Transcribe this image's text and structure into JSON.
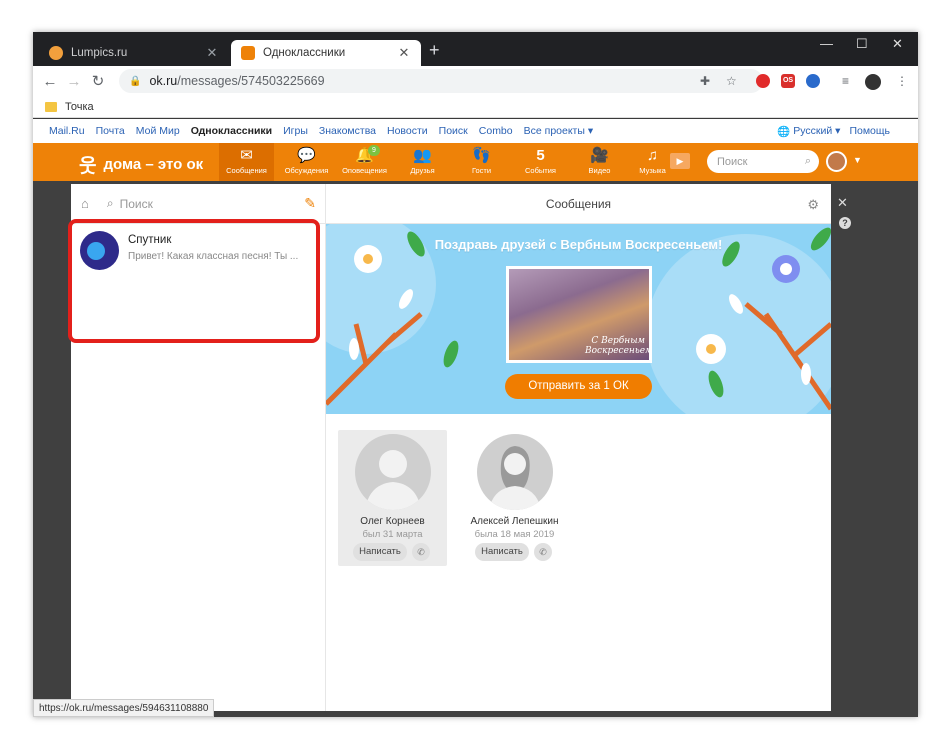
{
  "tabs": [
    {
      "title": "Lumpics.ru",
      "color": "#f2a03d"
    },
    {
      "title": "Одноклассники",
      "color": "#ee8208"
    }
  ],
  "toolbar": {
    "url_host": "ok.ru",
    "url_path": "/messages/574503225669",
    "ext_os": "OS"
  },
  "bookmark": "Точка",
  "portal": {
    "links": [
      "Mail.Ru",
      "Почта",
      "Мой Мир",
      "Одноклассники",
      "Игры",
      "Знакомства",
      "Новости",
      "Поиск",
      "Combo",
      "Все проекты ▾"
    ],
    "current": "Одноклассники",
    "language": "Русский ▾",
    "help": "Помощь"
  },
  "ok": {
    "logo": "дома – это ок",
    "nav": [
      {
        "label": "Сообщения",
        "icon": "✉",
        "active": true
      },
      {
        "label": "Обсуждения",
        "icon": "💬"
      },
      {
        "label": "Оповещения",
        "icon": "🔔",
        "badge": "9"
      },
      {
        "label": "Друзья",
        "icon": "👥"
      },
      {
        "label": "Гости",
        "icon": "👣"
      },
      {
        "label": "События",
        "icon": "5"
      },
      {
        "label": "Видео",
        "icon": "🎥"
      },
      {
        "label": "Музыка",
        "icon": "♫"
      }
    ],
    "search_placeholder": "Поиск"
  },
  "messages": {
    "search_placeholder": "Поиск",
    "title": "Сообщения",
    "conversation": {
      "name": "Спутник",
      "preview": "Привет! Какая классная песня! Ты ..."
    },
    "banner": {
      "title": "Поздравь друзей с Вербным Воскресеньем!",
      "image_caption": "С Вербным Воскресеньем",
      "button": "Отправить за 1 ОК"
    },
    "people": [
      {
        "name": "Олег Корнеев",
        "seen": "был 31 марта",
        "button": "Написать"
      },
      {
        "name": "Алексей Лепешкин",
        "seen": "была 18 мая 2019",
        "button": "Написать"
      }
    ]
  },
  "status_url": "https://ok.ru/messages/594631108880"
}
